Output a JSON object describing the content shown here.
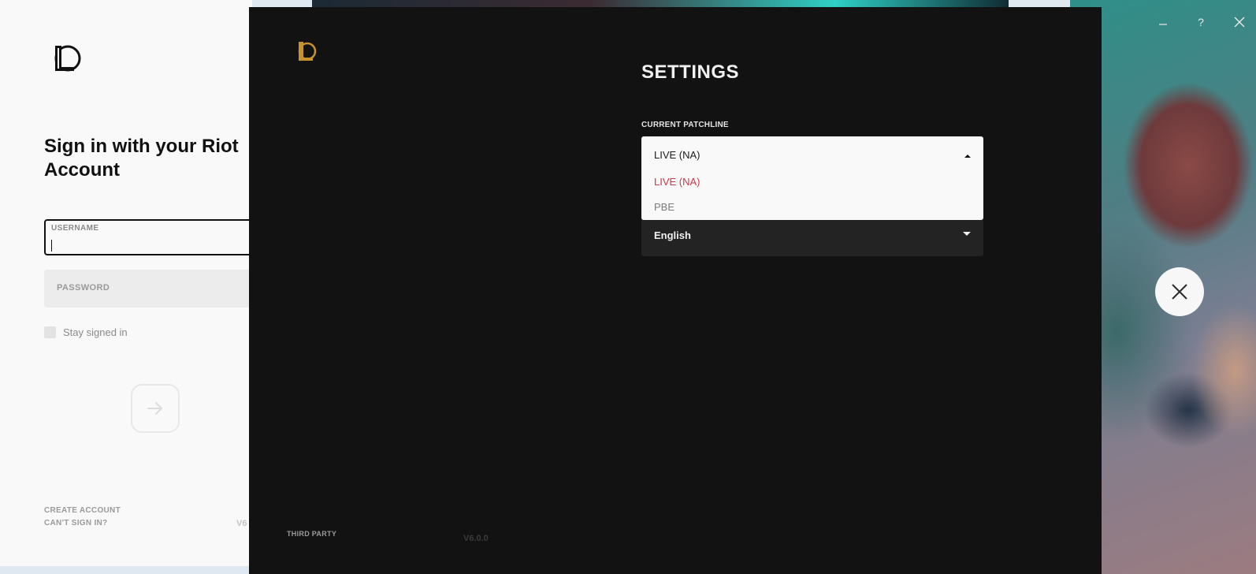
{
  "login": {
    "heading": "Sign in with your Riot Account",
    "username_label": "USERNAME",
    "username_value": "",
    "password_label": "PASSWORD",
    "stay_signed_in_label": "Stay signed in",
    "submit_icon": "arrow-right-icon",
    "create_account_label": "CREATE ACCOUNT",
    "cant_sign_in_label": "CAN'T SIGN IN?",
    "version_partial": "V6"
  },
  "settings": {
    "title": "SETTINGS",
    "patchline": {
      "label": "CURRENT PATCHLINE",
      "selected": "LIVE (NA)",
      "options": [
        "LIVE (NA)",
        "PBE"
      ]
    },
    "language": {
      "selected": "English"
    },
    "third_party_label": "THIRD PARTY",
    "version": "V6.0.0"
  },
  "window_controls": {
    "minimize": "minimize-icon",
    "help_label": "?",
    "close": "close-icon"
  },
  "colors": {
    "settings_bg": "#121212",
    "accent_gold": "#c8922e",
    "selected_option": "#c43b48",
    "login_bg": "#f9f9f9"
  }
}
